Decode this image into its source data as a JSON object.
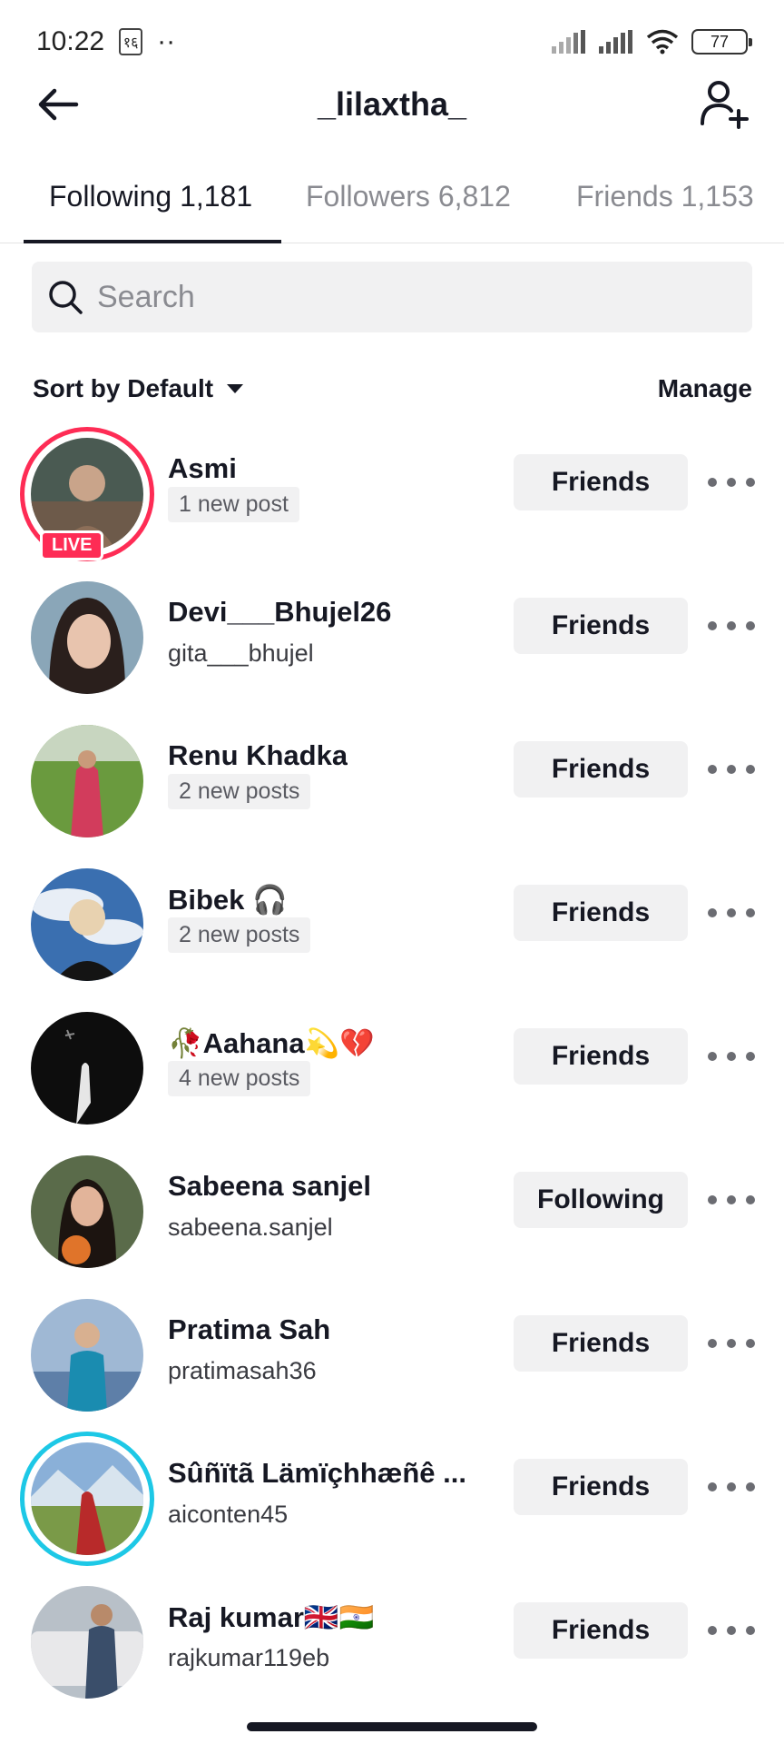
{
  "status_bar": {
    "time": "10:22",
    "indicator": "१६",
    "dots": "··",
    "battery": "77"
  },
  "header": {
    "title": "_lilaxtha_",
    "back_icon": "back-arrow-icon",
    "add_user_icon": "add-user-icon"
  },
  "tabs": [
    {
      "label": "Following 1,181",
      "active": true
    },
    {
      "label": "Followers 6,812",
      "active": false
    },
    {
      "label": "Friends 1,153",
      "active": false
    }
  ],
  "search": {
    "placeholder": "Search"
  },
  "sort": {
    "label": "Sort by Default",
    "manage_label": "Manage"
  },
  "users": [
    {
      "name": "Asmi",
      "sub": "1 new post",
      "sub_type": "chip",
      "button": "Friends",
      "ring": "live",
      "live_label": "LIVE"
    },
    {
      "name": "Devi___Bhujel26",
      "sub": "gita___bhujel",
      "sub_type": "handle",
      "button": "Friends"
    },
    {
      "name": "Renu Khadka",
      "sub": "2 new posts",
      "sub_type": "chip",
      "button": "Friends"
    },
    {
      "name": "Bibek 🎧",
      "sub": "2 new posts",
      "sub_type": "chip",
      "button": "Friends"
    },
    {
      "name": "🥀Aahana💫💔",
      "sub": "4 new posts",
      "sub_type": "chip",
      "button": "Friends"
    },
    {
      "name": "Sabeena sanjel",
      "sub": "sabeena.sanjel",
      "sub_type": "handle",
      "button": "Following"
    },
    {
      "name": "Pratima Sah",
      "sub": "pratimasah36",
      "sub_type": "handle",
      "button": "Friends"
    },
    {
      "name": "Sûñïtã Lämïçhhæñê ...",
      "sub": "aiconten45",
      "sub_type": "handle",
      "button": "Friends",
      "ring": "story"
    },
    {
      "name": "Raj kumar🇬🇧🇮🇳",
      "sub": "rajkumar119eb",
      "sub_type": "handle",
      "button": "Friends"
    }
  ],
  "colors": {
    "accent": "#fe2c55",
    "story_ring": "#1dc8e6",
    "button_bg": "#f1f1f2",
    "text": "#161823",
    "muted": "#8a8b91"
  }
}
